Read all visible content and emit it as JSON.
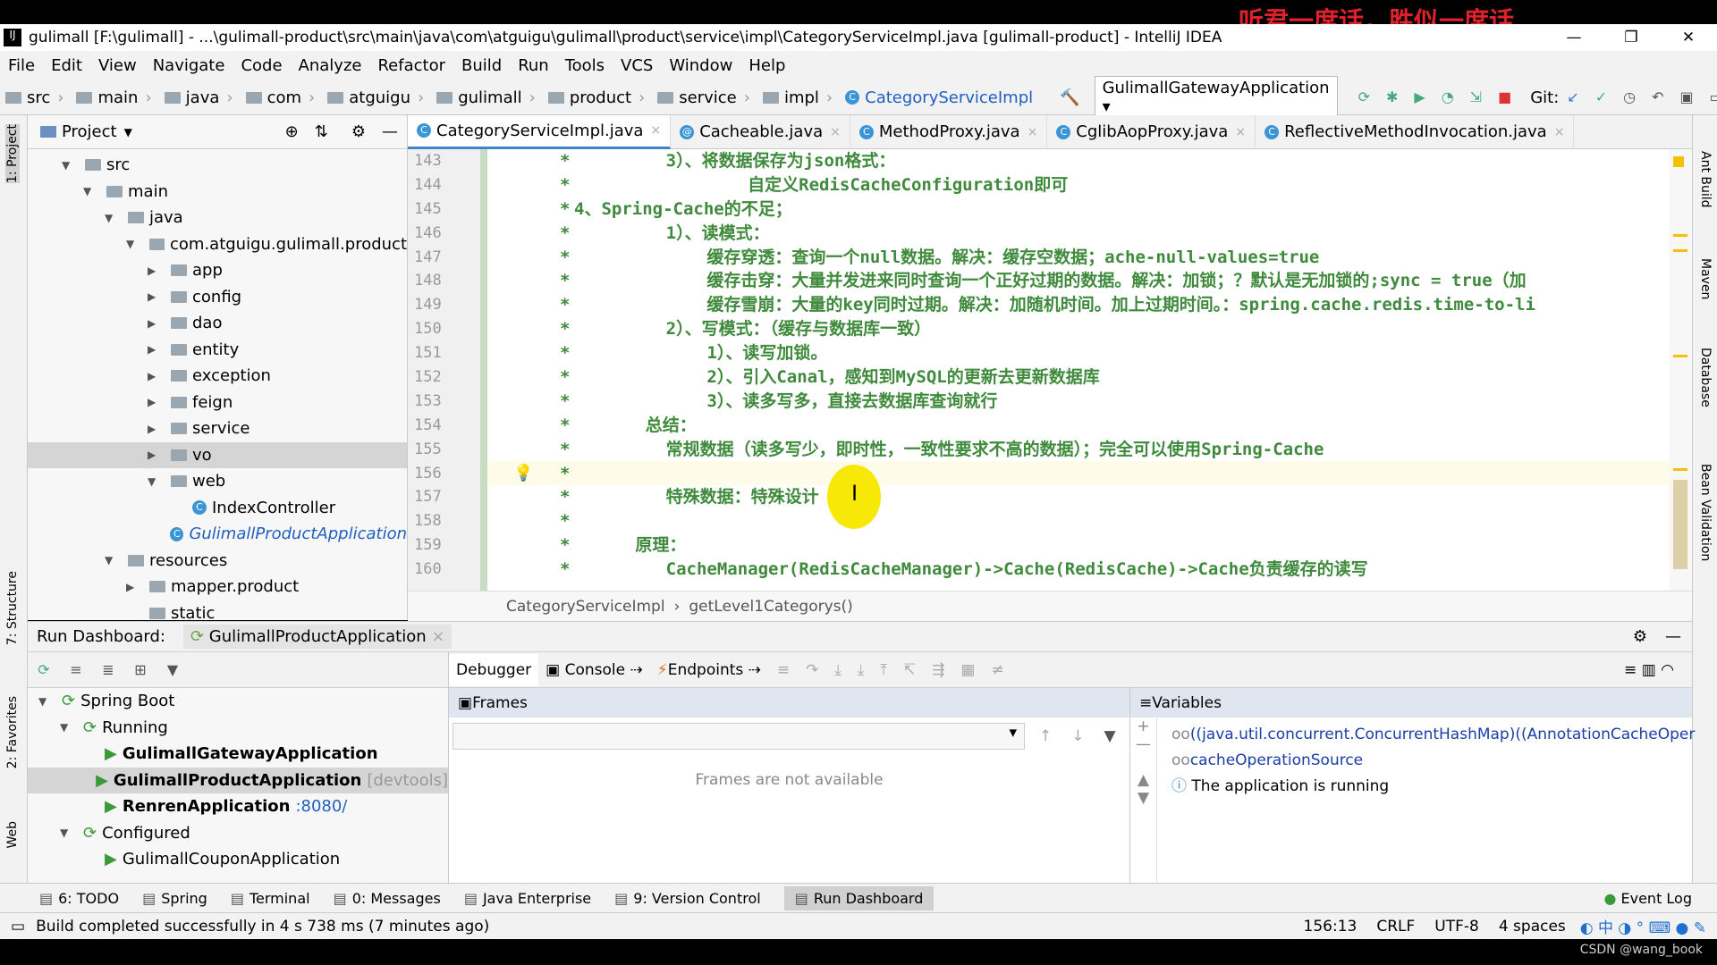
{
  "window": {
    "title": "gulimall [F:\\gulimall] - ...\\gulimall-product\\src\\main\\java\\com\\atguigu\\gulimall\\product\\service\\impl\\CategoryServiceImpl.java [gulimall-product] - IntelliJ IDEA",
    "watermark": "听君一席话，胜似一席话",
    "controls": [
      "—",
      "❐",
      "✕"
    ]
  },
  "menu": [
    "File",
    "Edit",
    "View",
    "Navigate",
    "Code",
    "Analyze",
    "Refactor",
    "Build",
    "Run",
    "Tools",
    "VCS",
    "Window",
    "Help"
  ],
  "nav": {
    "crumbs": [
      "src",
      "main",
      "java",
      "com",
      "atguigu",
      "gulimall",
      "product",
      "service",
      "impl",
      "CategoryServiceImpl"
    ],
    "run_config": "GulimallGatewayApplication",
    "git_label": "Git:"
  },
  "project": {
    "title": "Project",
    "items": [
      {
        "label": "src",
        "level": 2,
        "arrow": "down"
      },
      {
        "label": "main",
        "level": 3,
        "arrow": "down"
      },
      {
        "label": "java",
        "level": 4,
        "arrow": "down"
      },
      {
        "label": "com.atguigu.gulimall.product",
        "level": 5,
        "arrow": "down"
      },
      {
        "label": "app",
        "level": 6,
        "arrow": "right"
      },
      {
        "label": "config",
        "level": 6,
        "arrow": "right"
      },
      {
        "label": "dao",
        "level": 6,
        "arrow": "right"
      },
      {
        "label": "entity",
        "level": 6,
        "arrow": "right"
      },
      {
        "label": "exception",
        "level": 6,
        "arrow": "right"
      },
      {
        "label": "feign",
        "level": 6,
        "arrow": "right"
      },
      {
        "label": "service",
        "level": 6,
        "arrow": "right"
      },
      {
        "label": "vo",
        "level": 6,
        "arrow": "right"
      },
      {
        "label": "web",
        "level": 6,
        "arrow": "down"
      },
      {
        "label": "IndexController",
        "level": 7,
        "arrow": ""
      },
      {
        "label": "GulimallProductApplication",
        "level": 6,
        "arrow": ""
      },
      {
        "label": "resources",
        "level": 4,
        "arrow": "down"
      },
      {
        "label": "mapper.product",
        "level": 5,
        "arrow": "right"
      },
      {
        "label": "static",
        "level": 5,
        "arrow": ""
      }
    ]
  },
  "tabs": [
    "CategoryServiceImpl.java",
    "Cacheable.java",
    "MethodProxy.java",
    "CglibAopProxy.java",
    "ReflectiveMethodInvocation.java"
  ],
  "editor": {
    "lines": [
      {
        "n": "143",
        "text": "      3）、将数据保存为json格式："
      },
      {
        "n": "144",
        "text": "              自定义RedisCacheConfiguration即可"
      },
      {
        "n": "145",
        "text": "4、Spring-Cache的不足；",
        "nostar": true
      },
      {
        "n": "146",
        "text": "      1）、读模式："
      },
      {
        "n": "147",
        "text": "          缓存穿透：查询一个null数据。解决：缓存空数据；ache-null-values=true"
      },
      {
        "n": "148",
        "text": "          缓存击穿：大量并发进来同时查询一个正好过期的数据。解决：加锁；？默认是无加锁的;sync = true（加"
      },
      {
        "n": "149",
        "text": "          缓存雪崩：大量的key同时过期。解决：加随机时间。加上过期时间。：spring.cache.redis.time-to-li"
      },
      {
        "n": "150",
        "text": "      2）、写模式：（缓存与数据库一致）"
      },
      {
        "n": "151",
        "text": "          1）、读写加锁。"
      },
      {
        "n": "152",
        "text": "          2）、引入Canal，感知到MySQL的更新去更新数据库"
      },
      {
        "n": "153",
        "text": "          3）、读多写多，直接去数据库查询就行"
      },
      {
        "n": "154",
        "text": "    总结："
      },
      {
        "n": "155",
        "text": "      常规数据（读多写少，即时性，一致性要求不高的数据）；完全可以使用Spring-Cache"
      },
      {
        "n": "156",
        "text": ""
      },
      {
        "n": "157",
        "text": "      特殊数据：特殊设计"
      },
      {
        "n": "158",
        "text": ""
      },
      {
        "n": "159",
        "text": "   原理："
      },
      {
        "n": "160",
        "text": "      CacheManager(RedisCacheManager)->Cache(RedisCache)->Cache负责缓存的读写"
      }
    ],
    "breadcrumb": [
      "CategoryServiceImpl",
      "getLevel1Categorys()"
    ]
  },
  "right_tools": [
    "Ant Build",
    "Maven",
    "Database",
    "Bean Validation"
  ],
  "left_tools": [
    "1: Project",
    "7: Structure",
    "2: Favorites",
    "Web"
  ],
  "run_dashboard": {
    "label": "Run Dashboard:",
    "tab": "GulimallProductApplication",
    "tree": [
      {
        "label": "Spring Boot",
        "level": 0,
        "arrow": "down"
      },
      {
        "label": "Running",
        "level": 1,
        "arrow": "down"
      },
      {
        "label": "GulimallGatewayApplication",
        "level": 2,
        "bold": true
      },
      {
        "label": "GulimallProductApplication",
        "level": 2,
        "bold": true,
        "suffix": "[devtools]",
        "selected": true
      },
      {
        "label": "RenrenApplication",
        "level": 2,
        "bold": true,
        "suffix": ":8080/"
      },
      {
        "label": "Configured",
        "level": 1,
        "arrow": "down"
      },
      {
        "label": "GulimallCouponApplication",
        "level": 2
      }
    ]
  },
  "debugger": {
    "tabs": [
      "Debugger",
      "Console",
      "Endpoints"
    ],
    "frames_title": "Frames",
    "frames_empty": "Frames are not available",
    "variables_title": "Variables",
    "variables": [
      "((java.util.concurrent.ConcurrentHashMap)((AnnotationCacheOper",
      "cacheOperationSource",
      "The application is running"
    ]
  },
  "bottom_tabs": [
    "6: TODO",
    "Spring",
    "Terminal",
    "0: Messages",
    "Java Enterprise",
    "9: Version Control",
    "Run Dashboard"
  ],
  "event_log": "Event Log",
  "status": {
    "message": "Build completed successfully in 4 s 738 ms (7 minutes ago)",
    "position": "156:13",
    "line_sep": "CRLF",
    "encoding": "UTF-8",
    "indent": "4 spaces",
    "credit": "CSDN @wang_book"
  }
}
